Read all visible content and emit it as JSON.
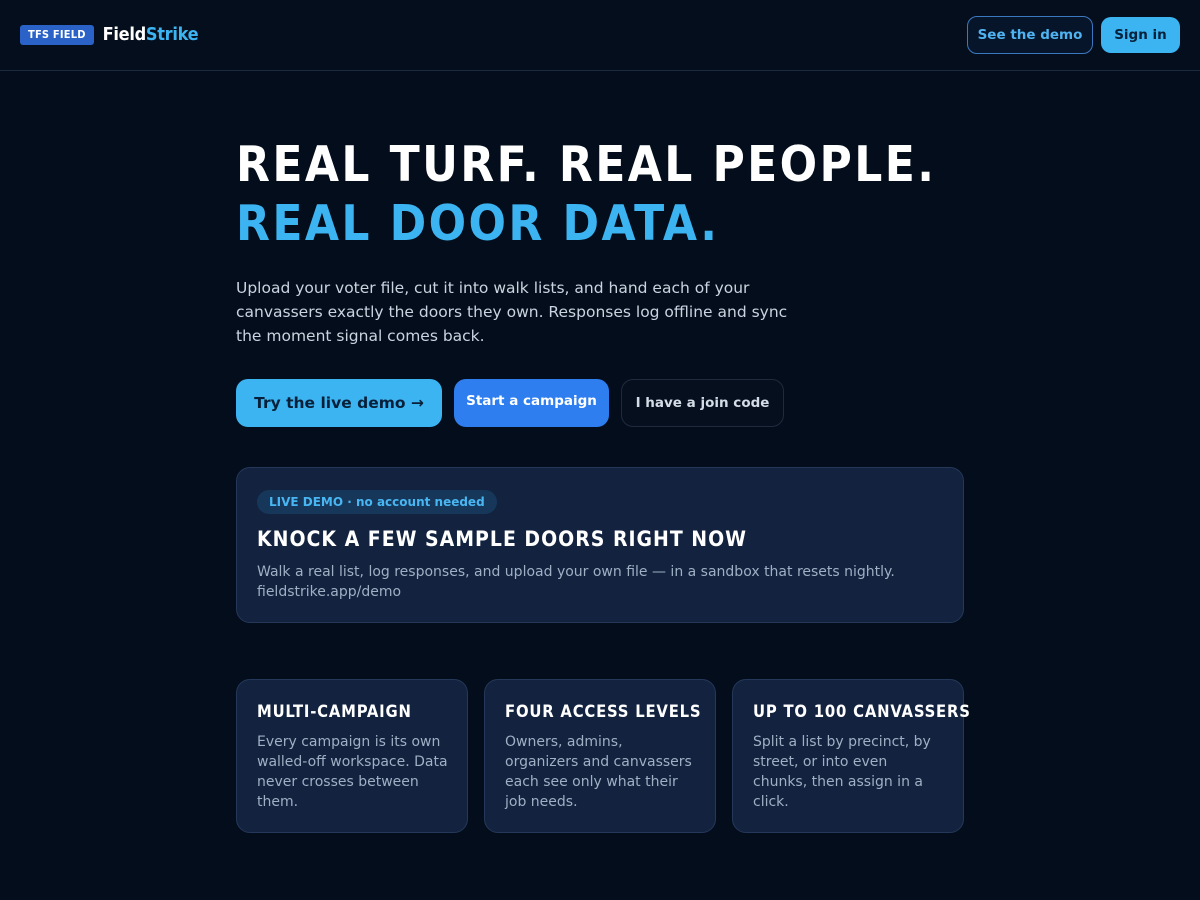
{
  "header": {
    "brand_badge": "TFS FIELD",
    "brand_name_part1": "Field",
    "brand_name_part2": "Strike",
    "see_demo_label": "See the demo",
    "sign_in_label": "Sign in"
  },
  "hero": {
    "title_line1": "REAL TURF. REAL PEOPLE.",
    "title_line2": "REAL DOOR DATA.",
    "subtitle": "Upload your voter file, cut it into walk lists, and hand each of your canvassers exactly the doors they own. Responses log offline and sync the moment signal comes back.",
    "cta_live_demo": "Try the live demo →",
    "cta_start_campaign": "Start a campaign",
    "cta_join_code": "I have a join code"
  },
  "demo_card": {
    "pill": "LIVE DEMO · no account needed",
    "title": "KNOCK A FEW SAMPLE DOORS RIGHT NOW",
    "description": "Walk a real list, log responses, and upload your own file — in a sandbox that resets nightly.",
    "url": "fieldstrike.app/demo"
  },
  "features": [
    {
      "title": "MULTI-CAMPAIGN",
      "description": "Every campaign is its own walled-off workspace. Data never crosses between them."
    },
    {
      "title": "FOUR ACCESS LEVELS",
      "description": "Owners, admins, organizers and canvassers each see only what their job needs."
    },
    {
      "title": "UP TO 100 CANVASSERS",
      "description": "Split a list by precinct, by street, or into even chunks, then assign in a click."
    }
  ],
  "colors": {
    "background": "#040d1b",
    "accent": "#3db4f2",
    "primary_button": "#2e7ef0",
    "card": "#12223f"
  }
}
